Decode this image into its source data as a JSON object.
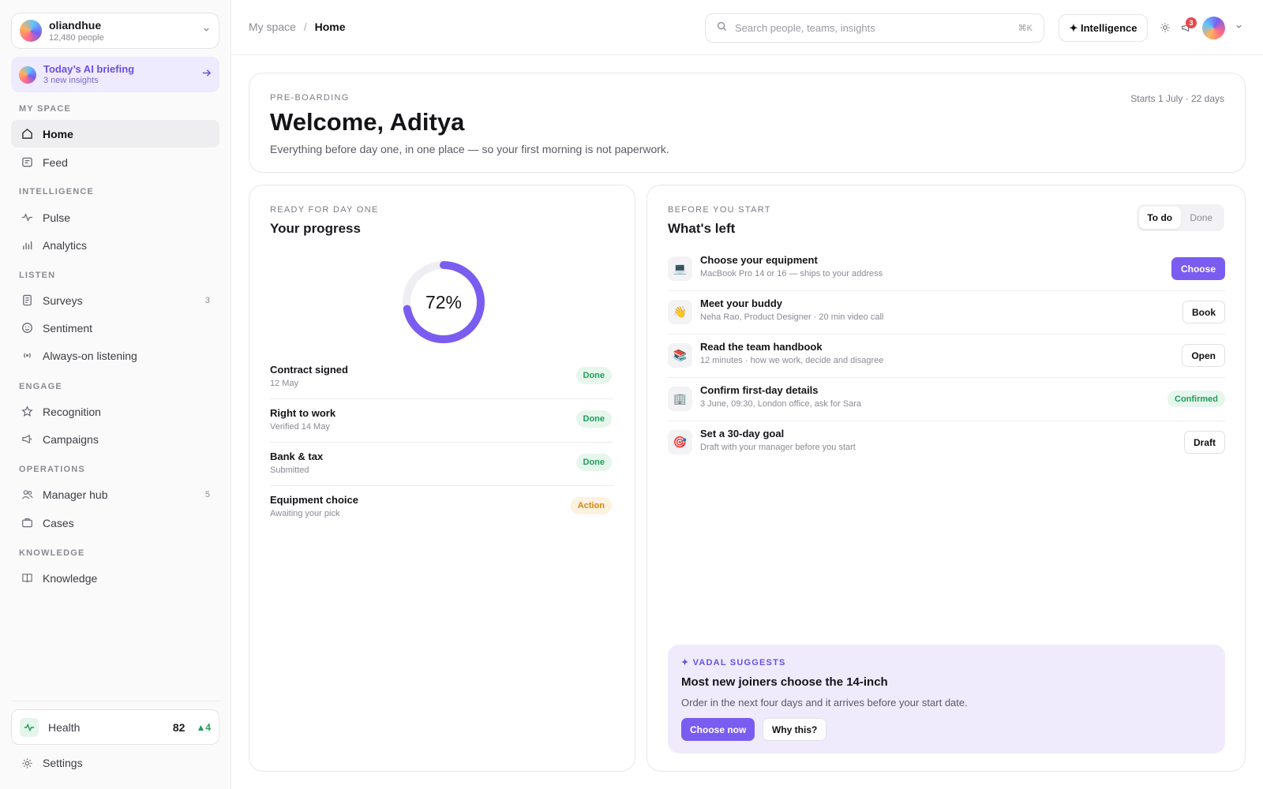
{
  "org": {
    "name": "oliandhue",
    "people": "12,480 people"
  },
  "briefing": {
    "title": "Today’s AI briefing",
    "sub": "3 new insights"
  },
  "sidebar": {
    "sections": [
      "MY SPACE",
      "INTELLIGENCE",
      "LISTEN",
      "ENGAGE",
      "OPERATIONS",
      "KNOWLEDGE"
    ],
    "items": [
      {
        "label": "Home",
        "icon": "home-icon",
        "active": true
      },
      {
        "label": "Feed",
        "icon": "feed-icon"
      },
      {
        "label": "Pulse",
        "icon": "pulse-icon"
      },
      {
        "label": "Analytics",
        "icon": "analytics-icon"
      },
      {
        "label": "Surveys",
        "icon": "survey-icon",
        "count": "3"
      },
      {
        "label": "Sentiment",
        "icon": "smile-icon"
      },
      {
        "label": "Always-on listening",
        "icon": "broadcast-icon"
      },
      {
        "label": "Recognition",
        "icon": "star-icon"
      },
      {
        "label": "Campaigns",
        "icon": "megaphone-icon"
      },
      {
        "label": "Manager hub",
        "icon": "people-icon",
        "count": "5"
      },
      {
        "label": "Cases",
        "icon": "briefcase-icon"
      },
      {
        "label": "Knowledge",
        "icon": "book-icon"
      }
    ],
    "health": {
      "label": "Health",
      "score": "82",
      "delta": "▲4"
    },
    "settings": "Settings"
  },
  "topbar": {
    "crumb_parent": "My space",
    "crumb_sep": "/",
    "crumb_current": "Home",
    "search_placeholder": "Search people, teams, insights",
    "search_shortcut": "⌘K",
    "intelligence_label": "✦ Intelligence",
    "notif_count": "3"
  },
  "welcome": {
    "eyebrow": "PRE-BOARDING",
    "title": "Welcome, Aditya",
    "desc": "Everything before day one, in one place — so your first morning is not paperwork.",
    "starts": "Starts 1 July · 22 days"
  },
  "progress": {
    "eyebrow": "READY FOR DAY ONE",
    "title": "Your progress",
    "percent_label": "72%",
    "percent": 72,
    "steps": [
      {
        "title": "Contract signed",
        "sub": "12 May",
        "status": "Done"
      },
      {
        "title": "Right to work",
        "sub": "Verified 14 May",
        "status": "Done"
      },
      {
        "title": "Bank & tax",
        "sub": "Submitted",
        "status": "Done"
      },
      {
        "title": "Equipment choice",
        "sub": "Awaiting your pick",
        "status": "Action"
      }
    ]
  },
  "tasks": {
    "eyebrow": "BEFORE YOU START",
    "title": "What's left",
    "toggle": [
      "To do",
      "Done"
    ],
    "items": [
      {
        "icon": "💻",
        "title": "Choose your equipment",
        "sub": "MacBook Pro 14 or 16 — ships to your address",
        "action": "Choose"
      },
      {
        "icon": "👋",
        "title": "Meet your buddy",
        "sub": "Neha Rao, Product Designer · 20 min video call",
        "action": "Book"
      },
      {
        "icon": "📚",
        "title": "Read the team handbook",
        "sub": "12 minutes · how we work, decide and disagree",
        "action": "Open"
      },
      {
        "icon": "🏢",
        "title": "Confirm first-day details",
        "sub": "3 June, 09:30, London office, ask for Sara",
        "action": "Confirmed"
      },
      {
        "icon": "🎯",
        "title": "Set a 30-day goal",
        "sub": "Draft with your manager before you start",
        "action": "Draft"
      }
    ]
  },
  "suggest": {
    "eyebrow": "✦ VADAL SUGGESTS",
    "title": "Most new joiners choose the 14-inch",
    "desc": "Order in the next four days and it arrives before your start date.",
    "primary": "Choose now",
    "secondary": "Why this?"
  },
  "colors": {
    "accent": "#7b5cf0",
    "success": "#1f9d5c",
    "warning": "#d1860e"
  }
}
